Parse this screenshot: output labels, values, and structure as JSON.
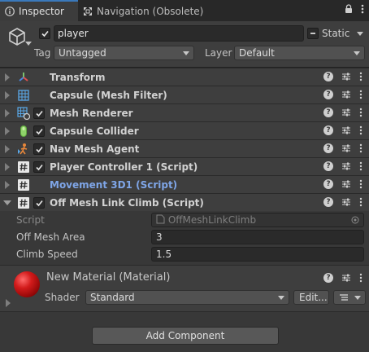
{
  "tabs": [
    {
      "label": "Inspector",
      "icon": "info-icon"
    },
    {
      "label": "Navigation (Obsolete)",
      "icon": "navigation-icon"
    }
  ],
  "header": {
    "object_name": "player",
    "static_label": "Static",
    "tag_label": "Tag",
    "tag_value": "Untagged",
    "layer_label": "Layer",
    "layer_value": "Default"
  },
  "components": [
    {
      "title": "Transform",
      "icon": "transform-icon",
      "has_checkbox": false
    },
    {
      "title": "Capsule (Mesh Filter)",
      "icon": "mesh-filter-icon",
      "has_checkbox": false
    },
    {
      "title": "Mesh Renderer",
      "icon": "mesh-renderer-icon",
      "has_checkbox": true
    },
    {
      "title": "Capsule Collider",
      "icon": "capsule-collider-icon",
      "has_checkbox": true
    },
    {
      "title": "Nav Mesh Agent",
      "icon": "nav-mesh-agent-icon",
      "has_checkbox": true
    },
    {
      "title": "Player Controller 1 (Script)",
      "icon": "script-icon",
      "has_checkbox": true
    },
    {
      "title": "Movement 3D1 (Script)",
      "icon": "script-icon",
      "has_checkbox": false
    },
    {
      "title": "Off Mesh Link Climb (Script)",
      "icon": "script-icon",
      "has_checkbox": true
    }
  ],
  "script_fields": {
    "script_label": "Script",
    "script_value": "OffMeshLinkClimb",
    "area_label": "Off Mesh Area",
    "area_value": "3",
    "speed_label": "Climb Speed",
    "speed_value": "1.5"
  },
  "material": {
    "title": "New Material (Material)",
    "shader_label": "Shader",
    "shader_value": "Standard",
    "edit_label": "Edit..."
  },
  "add_component_label": "Add Component",
  "colors": {
    "accent": "#3a79bb",
    "link": "#7fa6e8",
    "material_red": "#d21b1b",
    "background": "#383838"
  }
}
